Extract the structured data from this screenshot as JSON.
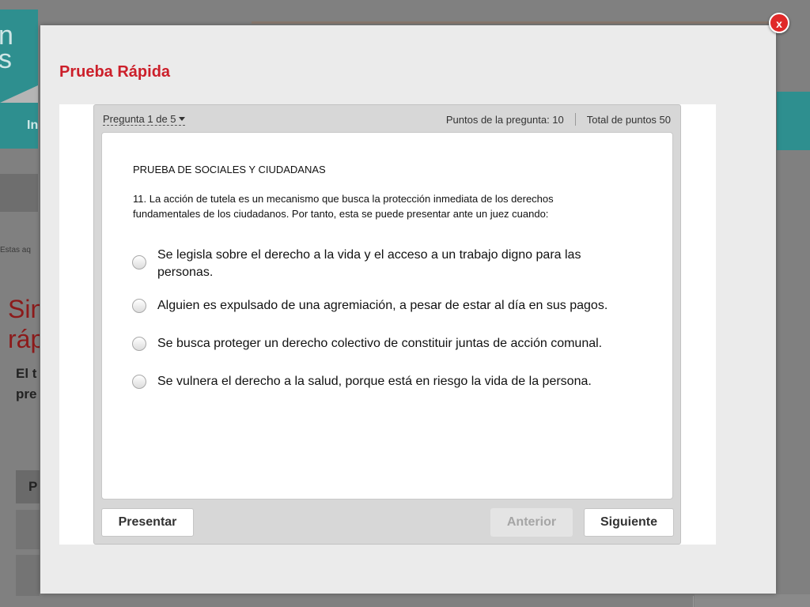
{
  "background": {
    "logo_text": "n\ns",
    "nav_text": "In",
    "breadcrumb": "Estas aq",
    "heading": "Sin ráp",
    "subtext": "El t pre",
    "tab_text": "P"
  },
  "modal": {
    "title": "Prueba Rápida",
    "close_label": "x"
  },
  "quiz": {
    "question_selector": "Pregunta 1 de 5",
    "question_points": "Puntos de la pregunta: 10",
    "total_points": "Total de puntos 50",
    "heading": "PRUEBA DE SOCIALES Y CIUDADANAS",
    "question": "11. La acción de tutela es un mecanismo que busca la protección inmediata de los derechos fundamentales de los ciudadanos. Por tanto, esta se puede presentar ante un juez cuando:",
    "options": [
      "Se legisla sobre el derecho a la vida y el acceso a un trabajo digno para las personas.",
      "Alguien es expulsado de una agremiación, a pesar de estar al día en sus pagos.",
      "Se busca proteger un derecho colectivo de constituir juntas de acción comunal.",
      "Se vulnera el derecho a la salud, porque está en riesgo la vida de la persona."
    ],
    "buttons": {
      "submit": "Presentar",
      "previous": "Anterior",
      "next": "Siguiente"
    }
  },
  "colors": {
    "accent_red": "#cc1f2a",
    "teal": "#2e8f8f",
    "close_red": "#e02828"
  }
}
